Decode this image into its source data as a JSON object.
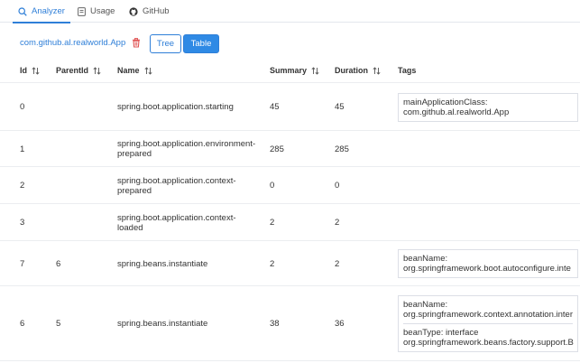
{
  "tabs": [
    {
      "label": "Analyzer",
      "icon": "search-icon",
      "active": true
    },
    {
      "label": "Usage",
      "icon": "document-icon",
      "active": false
    },
    {
      "label": "GitHub",
      "icon": "github-icon",
      "active": false
    }
  ],
  "toolbar": {
    "app_class": "com.github.al.realworld.App",
    "tree_label": "Tree",
    "table_label": "Table"
  },
  "table": {
    "headers": {
      "id": "Id",
      "parent_id": "ParentId",
      "name": "Name",
      "summary": "Summary",
      "duration": "Duration",
      "tags": "Tags"
    },
    "rows": [
      {
        "id": "0",
        "parent_id": "",
        "name": "spring.boot.application.starting",
        "summary": "45",
        "duration": "45",
        "tags": [
          {
            "line1": "mainApplicationClass:",
            "line2": "com.github.al.realworld.App"
          }
        ]
      },
      {
        "id": "1",
        "parent_id": "",
        "name": "spring.boot.application.environment-prepared",
        "summary": "285",
        "duration": "285",
        "tags": []
      },
      {
        "id": "2",
        "parent_id": "",
        "name": "spring.boot.application.context-prepared",
        "summary": "0",
        "duration": "0",
        "tags": []
      },
      {
        "id": "3",
        "parent_id": "",
        "name": "spring.boot.application.context-loaded",
        "summary": "2",
        "duration": "2",
        "tags": []
      },
      {
        "id": "7",
        "parent_id": "6",
        "name": "spring.beans.instantiate",
        "summary": "2",
        "duration": "2",
        "tags": [
          {
            "line1": "beanName:",
            "line2": "org.springframework.boot.autoconfigure.inte"
          }
        ]
      },
      {
        "id": "6",
        "parent_id": "5",
        "name": "spring.beans.instantiate",
        "summary": "38",
        "duration": "36",
        "tags": [
          {
            "line1": "beanName:",
            "line2": "org.springframework.context.annotation.inter"
          },
          {
            "line1": "beanType: interface",
            "line2": "org.springframework.beans.factory.support.B"
          }
        ]
      }
    ]
  },
  "colors": {
    "accent": "#2f7fd8",
    "button_fill": "#2f8ae5",
    "delete": "#e05555",
    "border": "#ebedf0"
  }
}
